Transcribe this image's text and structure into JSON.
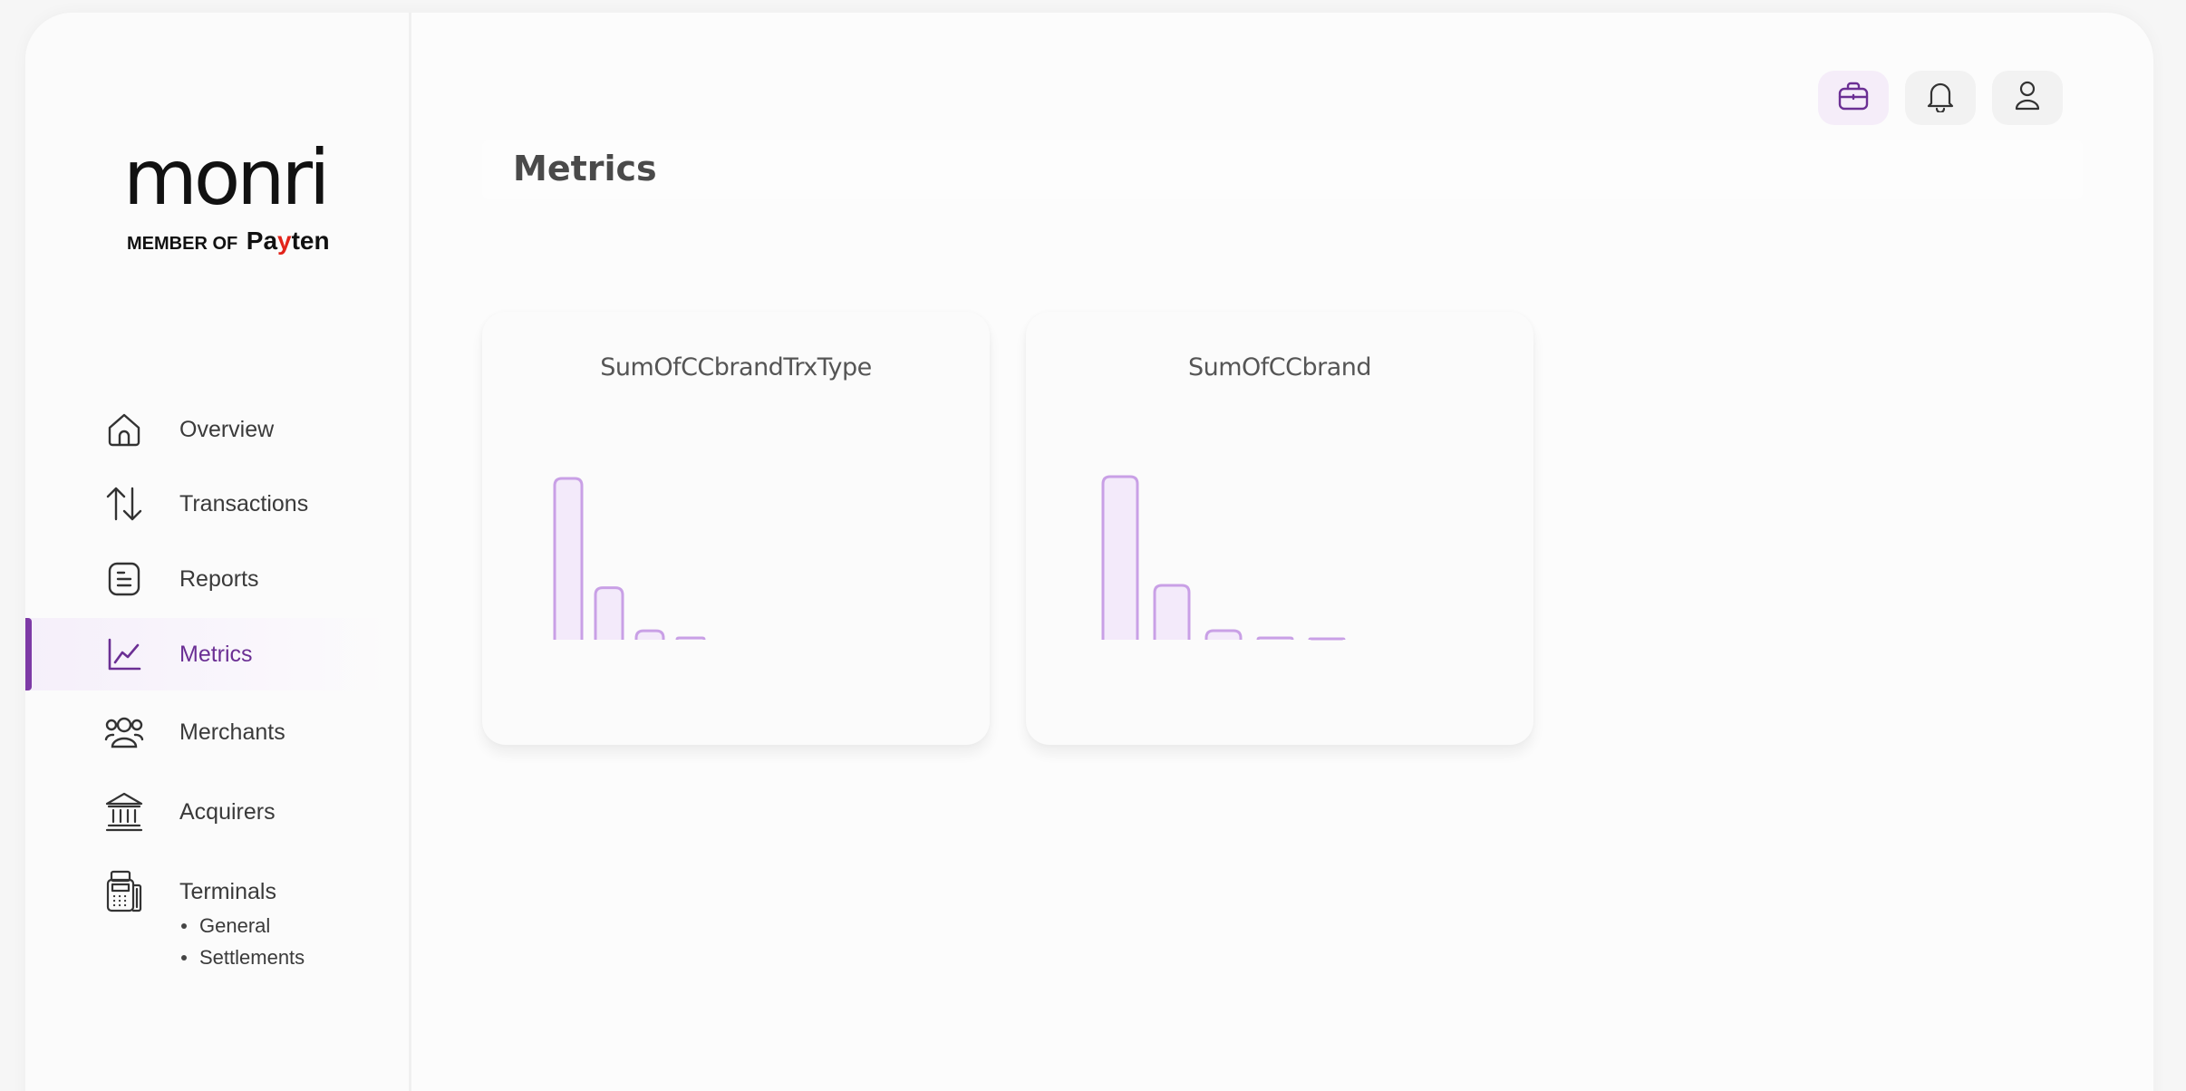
{
  "brand": {
    "logo_text": "monri",
    "member_of": "MEMBER OF",
    "partner_pre": "Pa",
    "partner_y": "y",
    "partner_post": "ten",
    "accent": "#7d3aa6",
    "partner_accent": "#e2231a"
  },
  "sidebar": {
    "items": [
      {
        "label": "Overview",
        "icon": "home-icon"
      },
      {
        "label": "Transactions",
        "icon": "arrows-updown-icon"
      },
      {
        "label": "Reports",
        "icon": "document-icon"
      },
      {
        "label": "Metrics",
        "icon": "line-chart-icon",
        "active": true
      },
      {
        "label": "Merchants",
        "icon": "users-icon"
      },
      {
        "label": "Acquirers",
        "icon": "bank-icon"
      },
      {
        "label": "Terminals",
        "icon": "pos-terminal-icon"
      }
    ],
    "terminals_sub": [
      "General",
      "Settlements"
    ]
  },
  "topbar": {
    "icons": [
      "briefcase-icon",
      "bell-icon",
      "user-icon"
    ]
  },
  "page": {
    "title": "Metrics"
  },
  "chart_data": [
    {
      "type": "bar",
      "title": "SumOfCCbrandTrxType",
      "categories": [
        "",
        "",
        "",
        ""
      ],
      "values": [
        180,
        58,
        10,
        2
      ],
      "ylim": [
        0,
        180
      ],
      "color": "#c9a0e6"
    },
    {
      "type": "bar",
      "title": "SumOfCCbrand",
      "categories": [
        "",
        "",
        "",
        "",
        ""
      ],
      "values": [
        180,
        60,
        10,
        2,
        0.5
      ],
      "ylim": [
        0,
        180
      ],
      "color": "#c9a0e6"
    }
  ]
}
